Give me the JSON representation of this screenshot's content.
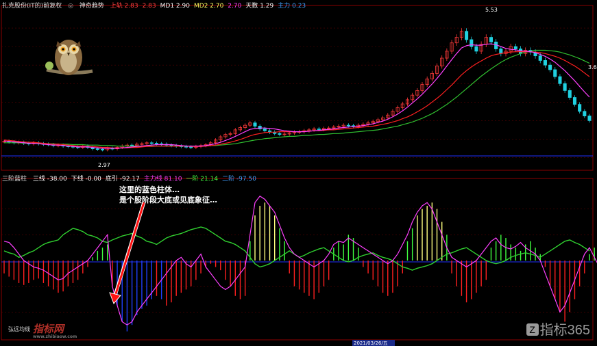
{
  "header_top": {
    "title": "扎克股份(IT的)前复权",
    "indicator": "神奇趋势",
    "values": [
      {
        "label": "上轨",
        "value": "2.83",
        "color": "#ff4040"
      },
      {
        "label": "",
        "value": "2.83",
        "color": "#ff4040"
      },
      {
        "label": "MD1",
        "value": "2.90",
        "color": "#ffffff"
      },
      {
        "label": "MD2",
        "value": "2.70",
        "color": "#ffff60"
      },
      {
        "label": "",
        "value": "2.70",
        "color": "#ff40ff"
      },
      {
        "label": "天数",
        "value": "1.29",
        "color": "#ffffff"
      },
      {
        "label": "主力",
        "value": "0.23",
        "color": "#40a0ff"
      }
    ]
  },
  "header_bottom": {
    "title": "三阶蓝柱",
    "values": [
      {
        "label": "三线",
        "value": "-38.00",
        "color": "#ffffff"
      },
      {
        "label": "下线",
        "value": "-0.00",
        "color": "#ffffff"
      },
      {
        "label": "底引",
        "value": "-92.17",
        "color": "#ffffff"
      },
      {
        "label": "主力线",
        "value": "81.10",
        "color": "#ff40ff"
      },
      {
        "label": "一阶",
        "value": "21.14",
        "color": "#40ff40"
      },
      {
        "label": "二阶",
        "value": "-97.50",
        "color": "#40a0ff"
      }
    ]
  },
  "annotation": {
    "line1": "这里的蓝色柱体…",
    "line2": "是个股阶段大底或见底象征…"
  },
  "sub_label": "弘远均线",
  "watermark_left": {
    "main": "指标网",
    "sub": "www.zhibiaow.com"
  },
  "watermark_right": {
    "main": "指标365"
  },
  "price_labels": {
    "high": "5.53",
    "low": "2.97",
    "right": "3.6"
  },
  "date_label": "2021/03/26/五",
  "chart_data": [
    {
      "type": "candlestick",
      "panel": "price",
      "description_series": [
        "price",
        "ma_magenta",
        "ma_red",
        "ma_green"
      ],
      "ylim": [
        2.6,
        6.0
      ],
      "n": 120,
      "close": [
        3.15,
        3.14,
        3.12,
        3.13,
        3.11,
        3.1,
        3.12,
        3.1,
        3.09,
        3.08,
        3.06,
        3.07,
        3.05,
        3.04,
        3.03,
        3.02,
        3.05,
        3.02,
        2.99,
        2.98,
        2.97,
        3.0,
        2.99,
        3.02,
        3.05,
        3.07,
        3.06,
        3.09,
        3.1,
        3.12,
        3.11,
        3.1,
        3.09,
        3.07,
        3.06,
        3.05,
        3.04,
        3.03,
        3.02,
        3.04,
        3.06,
        3.08,
        3.12,
        3.18,
        3.25,
        3.3,
        3.32,
        3.4,
        3.45,
        3.5,
        3.55,
        3.48,
        3.42,
        3.38,
        3.35,
        3.32,
        3.3,
        3.31,
        3.33,
        3.35,
        3.36,
        3.38,
        3.4,
        3.42,
        3.41,
        3.43,
        3.44,
        3.46,
        3.48,
        3.5,
        3.49,
        3.47,
        3.5,
        3.52,
        3.55,
        3.58,
        3.62,
        3.66,
        3.72,
        3.8,
        3.88,
        3.96,
        4.05,
        4.15,
        4.25,
        4.38,
        4.5,
        4.62,
        4.78,
        4.95,
        5.1,
        5.28,
        5.4,
        5.53,
        5.35,
        5.2,
        5.1,
        5.25,
        5.4,
        5.3,
        5.15,
        5.05,
        5.1,
        5.2,
        5.15,
        5.05,
        5.12,
        5.08,
        5.0,
        4.9,
        4.8,
        4.7,
        4.55,
        4.4,
        4.25,
        4.1,
        3.95,
        3.8,
        3.7,
        3.6
      ],
      "ma_magenta": [
        3.16,
        3.15,
        3.14,
        3.13,
        3.12,
        3.11,
        3.11,
        3.1,
        3.09,
        3.08,
        3.07,
        3.07,
        3.06,
        3.05,
        3.04,
        3.03,
        3.03,
        3.03,
        3.02,
        3.01,
        3.0,
        3.0,
        3.0,
        3.0,
        3.01,
        3.02,
        3.03,
        3.04,
        3.05,
        3.06,
        3.07,
        3.08,
        3.08,
        3.08,
        3.08,
        3.07,
        3.06,
        3.05,
        3.05,
        3.05,
        3.05,
        3.06,
        3.08,
        3.1,
        3.13,
        3.17,
        3.21,
        3.26,
        3.31,
        3.36,
        3.41,
        3.43,
        3.44,
        3.44,
        3.43,
        3.42,
        3.4,
        3.38,
        3.37,
        3.36,
        3.36,
        3.36,
        3.37,
        3.38,
        3.39,
        3.4,
        3.41,
        3.42,
        3.44,
        3.45,
        3.46,
        3.47,
        3.48,
        3.49,
        3.51,
        3.53,
        3.56,
        3.59,
        3.63,
        3.68,
        3.74,
        3.81,
        3.89,
        3.98,
        4.07,
        4.17,
        4.28,
        4.39,
        4.51,
        4.64,
        4.78,
        4.92,
        5.05,
        5.17,
        5.22,
        5.24,
        5.23,
        5.23,
        5.25,
        5.26,
        5.24,
        5.2,
        5.16,
        5.14,
        5.13,
        5.11,
        5.1,
        5.09,
        5.07,
        5.03,
        4.99,
        4.93,
        4.86,
        4.77,
        4.68,
        4.57,
        4.46,
        4.34,
        4.22,
        4.11
      ],
      "ma_red": [
        3.18,
        3.17,
        3.16,
        3.15,
        3.14,
        3.13,
        3.13,
        3.12,
        3.11,
        3.1,
        3.09,
        3.09,
        3.08,
        3.07,
        3.06,
        3.05,
        3.05,
        3.04,
        3.04,
        3.03,
        3.02,
        3.02,
        3.01,
        3.01,
        3.01,
        3.01,
        3.02,
        3.02,
        3.03,
        3.04,
        3.04,
        3.05,
        3.05,
        3.05,
        3.05,
        3.05,
        3.05,
        3.05,
        3.04,
        3.04,
        3.04,
        3.05,
        3.06,
        3.07,
        3.09,
        3.11,
        3.13,
        3.16,
        3.19,
        3.23,
        3.27,
        3.3,
        3.32,
        3.34,
        3.35,
        3.35,
        3.36,
        3.36,
        3.36,
        3.36,
        3.36,
        3.37,
        3.37,
        3.38,
        3.38,
        3.39,
        3.4,
        3.4,
        3.41,
        3.42,
        3.43,
        3.44,
        3.45,
        3.46,
        3.47,
        3.48,
        3.5,
        3.52,
        3.54,
        3.57,
        3.6,
        3.64,
        3.68,
        3.73,
        3.79,
        3.85,
        3.92,
        4.0,
        4.08,
        4.17,
        4.27,
        4.37,
        4.48,
        4.59,
        4.68,
        4.76,
        4.83,
        4.89,
        4.95,
        5.0,
        5.03,
        5.05,
        5.07,
        5.08,
        5.09,
        5.09,
        5.09,
        5.09,
        5.08,
        5.07,
        5.05,
        5.02,
        4.99,
        4.95,
        4.9,
        4.84,
        4.78,
        4.71,
        4.63,
        4.55
      ],
      "ma_green": [
        3.12,
        3.12,
        3.12,
        3.12,
        3.11,
        3.11,
        3.11,
        3.11,
        3.1,
        3.1,
        3.1,
        3.09,
        3.09,
        3.09,
        3.08,
        3.08,
        3.08,
        3.07,
        3.07,
        3.07,
        3.06,
        3.06,
        3.06,
        3.05,
        3.05,
        3.05,
        3.05,
        3.05,
        3.05,
        3.05,
        3.05,
        3.05,
        3.05,
        3.05,
        3.05,
        3.05,
        3.05,
        3.05,
        3.05,
        3.05,
        3.05,
        3.05,
        3.06,
        3.06,
        3.07,
        3.08,
        3.09,
        3.1,
        3.12,
        3.14,
        3.16,
        3.18,
        3.19,
        3.21,
        3.22,
        3.23,
        3.24,
        3.25,
        3.26,
        3.26,
        3.27,
        3.28,
        3.28,
        3.29,
        3.3,
        3.3,
        3.31,
        3.32,
        3.32,
        3.33,
        3.34,
        3.35,
        3.36,
        3.37,
        3.38,
        3.39,
        3.4,
        3.42,
        3.44,
        3.46,
        3.48,
        3.51,
        3.54,
        3.57,
        3.61,
        3.65,
        3.7,
        3.75,
        3.81,
        3.88,
        3.95,
        4.03,
        4.11,
        4.2,
        4.29,
        4.38,
        4.47,
        4.56,
        4.64,
        4.72,
        4.79,
        4.86,
        4.92,
        4.97,
        5.01,
        5.05,
        5.08,
        5.1,
        5.12,
        5.12,
        5.12,
        5.11,
        5.1,
        5.08,
        5.05,
        5.02,
        4.98,
        4.94,
        4.89,
        4.84
      ]
    },
    {
      "type": "bar",
      "panel": "oscillator",
      "ylim": [
        -120,
        120
      ],
      "values": [
        -20,
        -25,
        -30,
        -35,
        -38,
        -35,
        -30,
        -28,
        -35,
        -40,
        -45,
        -50,
        -48,
        -40,
        -35,
        -30,
        -20,
        -10,
        5,
        15,
        20,
        25,
        -40,
        -70,
        -95,
        -110,
        -100,
        -85,
        -75,
        -70,
        -60,
        -55,
        -60,
        -70,
        -65,
        -55,
        -50,
        -45,
        -40,
        -30,
        -20,
        -10,
        -5,
        -10,
        -15,
        -30,
        -40,
        -55,
        -60,
        -55,
        30,
        70,
        85,
        90,
        85,
        70,
        50,
        30,
        -20,
        -40,
        -45,
        -50,
        -55,
        -60,
        -50,
        -40,
        -30,
        20,
        30,
        25,
        40,
        35,
        20,
        -10,
        -20,
        -30,
        -40,
        -50,
        -55,
        -50,
        -40,
        -20,
        30,
        50,
        70,
        80,
        85,
        90,
        80,
        60,
        40,
        -20,
        -40,
        -55,
        -65,
        -60,
        -50,
        -40,
        -30,
        20,
        30,
        40,
        35,
        25,
        20,
        15,
        25,
        30,
        20,
        10,
        -10,
        -40,
        -60,
        -80,
        -95,
        -80,
        -60,
        -40,
        -20,
        10,
        20,
        -10,
        -30,
        -50
      ],
      "main_line": [
        30,
        28,
        20,
        10,
        0,
        -5,
        -10,
        -12,
        -15,
        -20,
        -25,
        -30,
        -28,
        -20,
        -15,
        -10,
        -5,
        0,
        10,
        20,
        30,
        40,
        -40,
        -70,
        -95,
        -100,
        -95,
        -80,
        -70,
        -60,
        -50,
        -40,
        -30,
        -20,
        -10,
        0,
        5,
        -5,
        -10,
        0,
        10,
        -10,
        -20,
        -30,
        -40,
        -45,
        -40,
        -30,
        -20,
        -10,
        40,
        90,
        100,
        95,
        85,
        75,
        55,
        35,
        20,
        10,
        5,
        0,
        -5,
        -10,
        -5,
        0,
        10,
        25,
        30,
        28,
        35,
        30,
        25,
        20,
        15,
        10,
        5,
        0,
        -5,
        0,
        10,
        25,
        40,
        60,
        75,
        85,
        90,
        80,
        60,
        40,
        20,
        5,
        0,
        -5,
        -10,
        -5,
        0,
        10,
        20,
        30,
        35,
        25,
        20,
        18,
        22,
        28,
        20,
        15,
        10,
        0,
        -20,
        -40,
        -60,
        -80,
        -70,
        -50,
        -30,
        -10,
        10,
        20,
        5,
        -10,
        -20
      ],
      "green_line": [
        15,
        12,
        10,
        5,
        8,
        12,
        15,
        20,
        25,
        28,
        30,
        32,
        40,
        45,
        50,
        48,
        45,
        40,
        38,
        35,
        30,
        28,
        32,
        35,
        38,
        40,
        42,
        38,
        35,
        30,
        28,
        25,
        30,
        35,
        38,
        40,
        42,
        45,
        48,
        50,
        52,
        50,
        45,
        40,
        35,
        30,
        28,
        25,
        20,
        15,
        5,
        -5,
        -10,
        -8,
        -5,
        0,
        5,
        10,
        15,
        10,
        5,
        8,
        12,
        15,
        18,
        20,
        15,
        10,
        5,
        0,
        -2,
        0,
        5,
        8,
        10,
        12,
        8,
        5,
        3,
        0,
        -5,
        -10,
        -12,
        -15,
        -12,
        -10,
        -8,
        -5,
        0,
        5,
        10,
        12,
        15,
        18,
        20,
        15,
        10,
        5,
        0,
        -3,
        -5,
        -3,
        0,
        5,
        8,
        10,
        12,
        10,
        8,
        5,
        10,
        15,
        20,
        25,
        30,
        32,
        28,
        25,
        20,
        15
      ]
    }
  ]
}
